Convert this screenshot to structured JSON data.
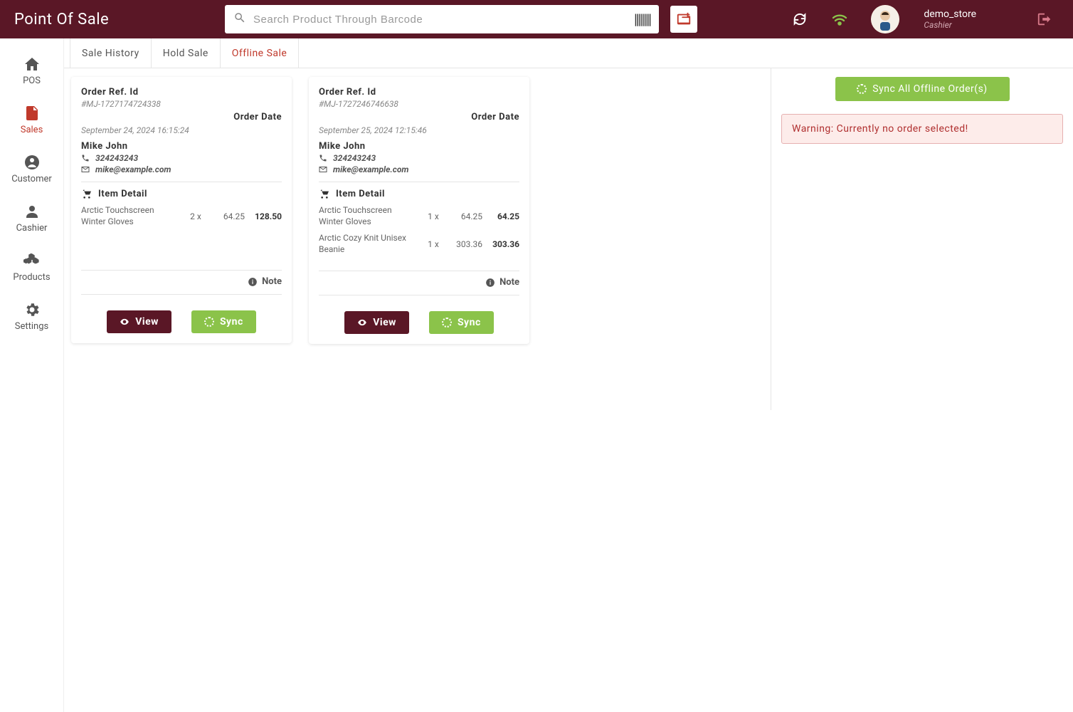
{
  "brand": "Point Of Sale",
  "search": {
    "placeholder": "Search Product Through Barcode"
  },
  "user": {
    "name": "demo_store",
    "role": "Cashier"
  },
  "sidebar": {
    "items": [
      {
        "label": "POS"
      },
      {
        "label": "Sales"
      },
      {
        "label": "Customer"
      },
      {
        "label": "Cashier"
      },
      {
        "label": "Products"
      },
      {
        "label": "Settings"
      }
    ]
  },
  "tabs": [
    {
      "label": "Sale History"
    },
    {
      "label": "Hold Sale"
    },
    {
      "label": "Offline Sale"
    }
  ],
  "active_tab": 2,
  "labels": {
    "order_ref": "Order Ref. Id",
    "order_date": "Order Date",
    "item_detail": "Item Detail",
    "note": "Note",
    "view": "View",
    "sync": "Sync",
    "sync_all": "Sync All Offline Order(s)"
  },
  "warning": "Warning: Currently no order selected!",
  "orders": [
    {
      "ref_id": "#MJ-1727174724338",
      "date": "September 24, 2024 16:15:24",
      "customer": {
        "name": "Mike John",
        "phone": "324243243",
        "email": "mike@example.com"
      },
      "items": [
        {
          "name": "Arctic Touchscreen Winter Gloves",
          "qty": "2 x",
          "price": "64.25",
          "total": "128.50"
        }
      ]
    },
    {
      "ref_id": "#MJ-1727246746638",
      "date": "September 25, 2024 12:15:46",
      "customer": {
        "name": "Mike John",
        "phone": "324243243",
        "email": "mike@example.com"
      },
      "items": [
        {
          "name": "Arctic Touchscreen Winter Gloves",
          "qty": "1 x",
          "price": "64.25",
          "total": "64.25"
        },
        {
          "name": "Arctic Cozy Knit Unisex Beanie",
          "qty": "1 x",
          "price": "303.36",
          "total": "303.36"
        }
      ]
    }
  ]
}
